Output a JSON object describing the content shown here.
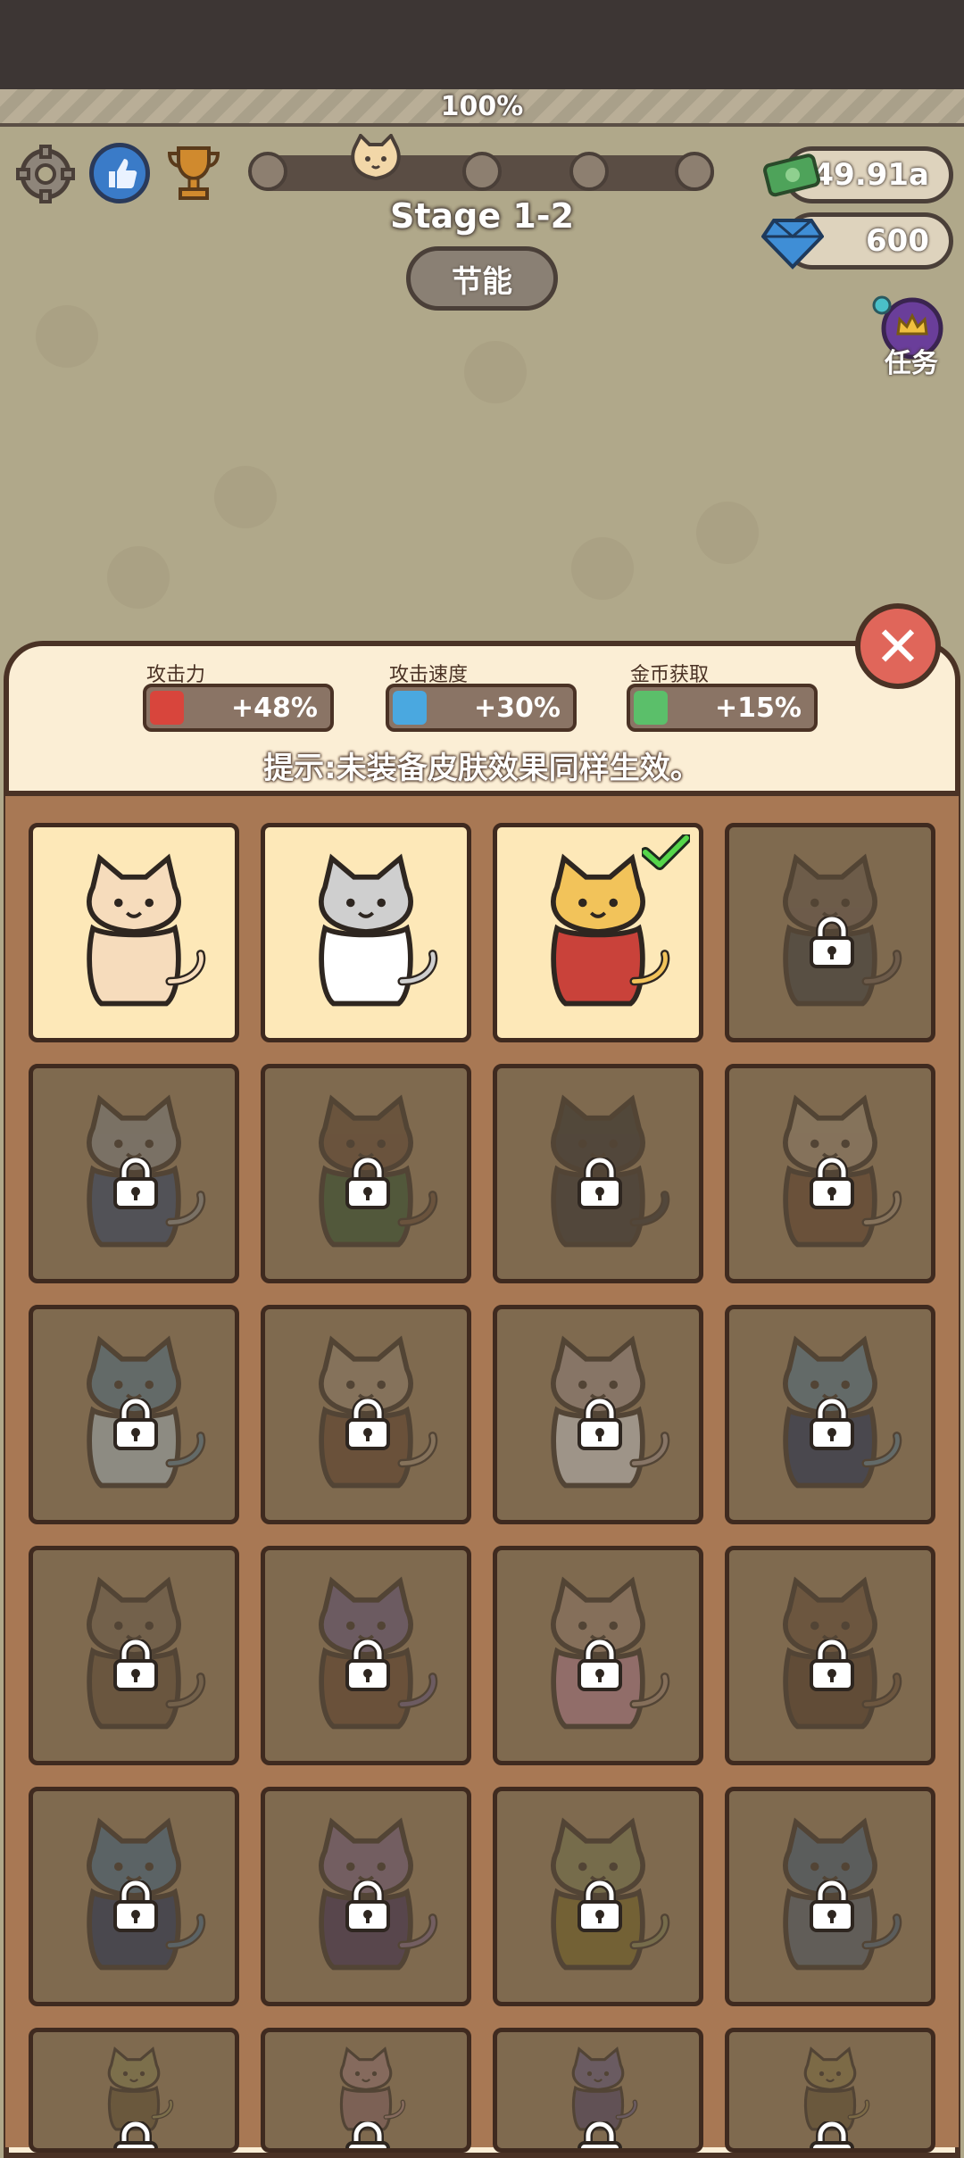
{
  "hud": {
    "progress_percent": 100,
    "progress_text": "100%",
    "stage_title": "Stage 1-2",
    "energy_button": "节能",
    "currency_cash": "49.91a",
    "currency_gems": "600",
    "task_label": "任务"
  },
  "icons": {
    "settings": "gear-icon",
    "like": "thumbs-up-icon",
    "trophy": "trophy-icon",
    "cash": "cash-icon",
    "gem": "diamond-icon",
    "task": "crown-medal-icon",
    "close": "close-icon"
  },
  "skin_panel": {
    "stats": [
      {
        "label": "攻击力",
        "value": "+48%",
        "icon": "fist-icon",
        "color": "#d8453c"
      },
      {
        "label": "攻击速度",
        "value": "+30%",
        "icon": "sword-icon",
        "color": "#4aa8e0"
      },
      {
        "label": "金币获取",
        "value": "+15%",
        "icon": "cash-icon",
        "color": "#5bbf6a"
      }
    ],
    "hint": "提示:未装备皮肤效果同样生效。",
    "skins": [
      {
        "name": "cream-cat",
        "locked": false,
        "equipped": false,
        "fur": "#f6dcbc",
        "outfit": "#f6dcbc"
      },
      {
        "name": "grey-sailor-cat",
        "locked": false,
        "equipped": false,
        "fur": "#cfcfcf",
        "outfit": "#ffffff"
      },
      {
        "name": "orange-jacket-cat",
        "locked": false,
        "equipped": true,
        "fur": "#f2c35a",
        "outfit": "#c9423a"
      },
      {
        "name": "tabby-dress-cat",
        "locked": true,
        "equipped": false,
        "fur": "#5f5046",
        "outfit": "#3a3a3a"
      },
      {
        "name": "grey-vest-cat",
        "locked": true,
        "equipped": false,
        "fur": "#777777",
        "outfit": "#2e3f5e"
      },
      {
        "name": "brown-green-cat",
        "locked": true,
        "equipped": false,
        "fur": "#5a4230",
        "outfit": "#2e4a2c"
      },
      {
        "name": "black-cat",
        "locked": true,
        "equipped": false,
        "fur": "#2f2c2b",
        "outfit": "#2f2c2b"
      },
      {
        "name": "maid-cat",
        "locked": true,
        "equipped": false,
        "fur": "#8a7a66",
        "outfit": "#5a3e2a"
      },
      {
        "name": "sailor-cat",
        "locked": true,
        "equipped": false,
        "fur": "#4d6a7e",
        "outfit": "#9aa6ad"
      },
      {
        "name": "chef-cat",
        "locked": true,
        "equipped": false,
        "fur": "#8a7a66",
        "outfit": "#5a3e2a"
      },
      {
        "name": "nurse-cat",
        "locked": true,
        "equipped": false,
        "fur": "#8f7e7a",
        "outfit": "#b8b8b8"
      },
      {
        "name": "police-cat",
        "locked": true,
        "equipped": false,
        "fur": "#4d6a7e",
        "outfit": "#1f2d4e"
      },
      {
        "name": "detective-cat",
        "locked": true,
        "equipped": false,
        "fur": "#6b5a48",
        "outfit": "#5a4632"
      },
      {
        "name": "wizard-cat",
        "locked": true,
        "equipped": false,
        "fur": "#5e5070",
        "outfit": "#5a3e2a"
      },
      {
        "name": "princess-cat",
        "locked": true,
        "equipped": false,
        "fur": "#8a7464",
        "outfit": "#a07080"
      },
      {
        "name": "brown-beret-cat",
        "locked": true,
        "equipped": false,
        "fur": "#5e4632",
        "outfit": "#4a3525"
      },
      {
        "name": "blue-cap-cat",
        "locked": true,
        "equipped": false,
        "fur": "#3f5e78",
        "outfit": "#1f2d4e"
      },
      {
        "name": "witch-cat",
        "locked": true,
        "equipped": false,
        "fur": "#6a5670",
        "outfit": "#3a2a4a"
      },
      {
        "name": "gold-dress-cat",
        "locked": true,
        "equipped": false,
        "fur": "#6f6e48",
        "outfit": "#6a5a20"
      },
      {
        "name": "armor-cat",
        "locked": true,
        "equipped": false,
        "fur": "#3f5468",
        "outfit": "#4a5460"
      },
      {
        "name": "crown-cat-1",
        "locked": true,
        "equipped": false,
        "fur": "#7a7448",
        "outfit": "#5a4a30"
      },
      {
        "name": "tiara-cat",
        "locked": true,
        "equipped": false,
        "fur": "#8a6a6a",
        "outfit": "#7a5a5a"
      },
      {
        "name": "crown-cat-2",
        "locked": true,
        "equipped": false,
        "fur": "#5a5070",
        "outfit": "#4a3e5a"
      },
      {
        "name": "crown-cat-3",
        "locked": true,
        "equipped": false,
        "fur": "#7a6a40",
        "outfit": "#5a4a30"
      }
    ]
  }
}
